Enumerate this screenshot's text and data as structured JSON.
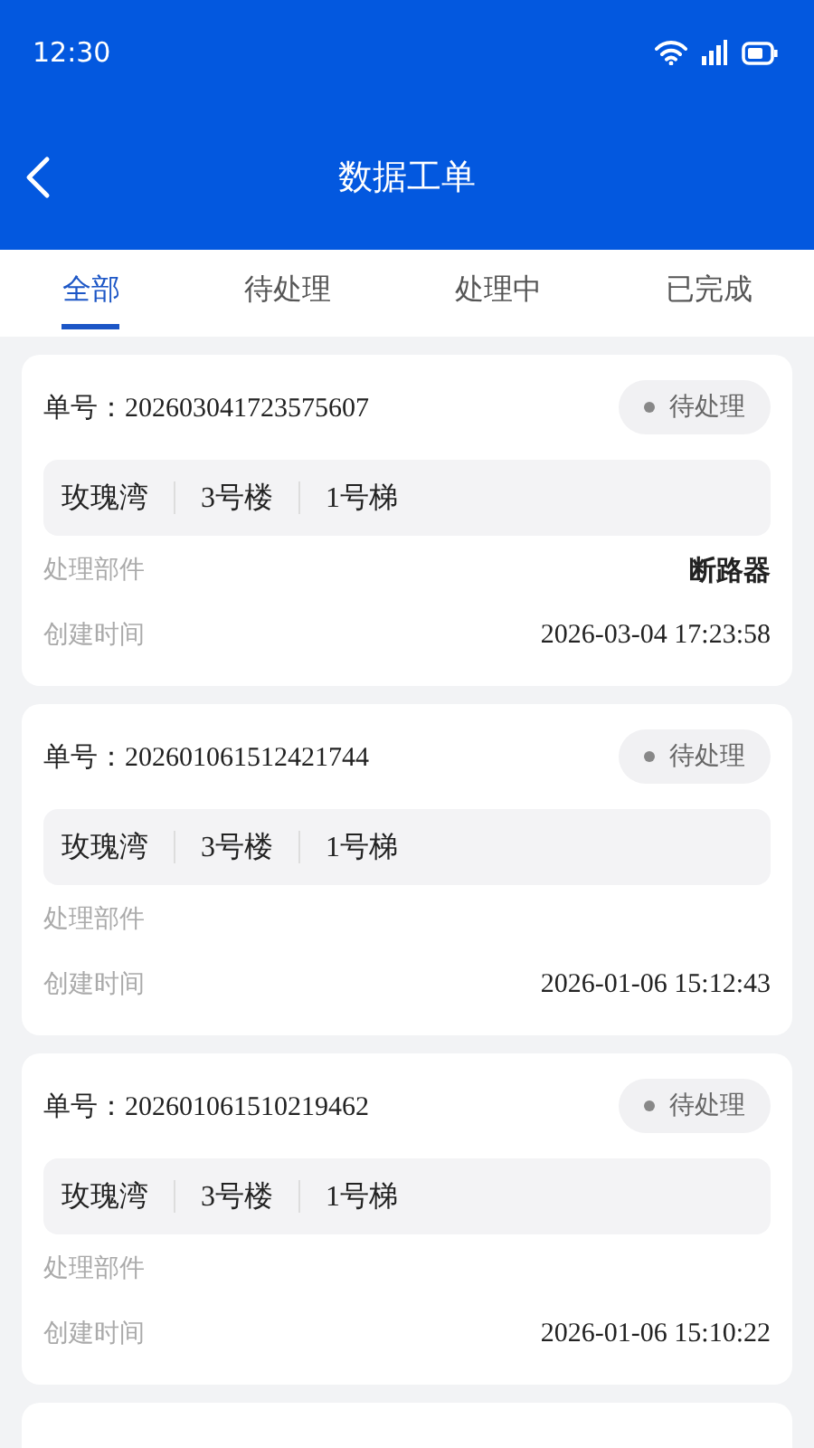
{
  "status_bar": {
    "time": "12:30"
  },
  "header": {
    "title": "数据工单"
  },
  "tabs": [
    {
      "label": "全部",
      "selected": true
    },
    {
      "label": "待处理",
      "selected": false
    },
    {
      "label": "处理中",
      "selected": false
    },
    {
      "label": "已完成",
      "selected": false
    }
  ],
  "orders": [
    {
      "number_label": "单号：",
      "number": "202603041723575607",
      "status": "待处理",
      "location": [
        "玫瑰湾",
        "3号楼",
        "1号梯"
      ],
      "part_label": "处理部件",
      "part": "断路器",
      "time_label": "创建时间",
      "time": "2026-03-04 17:23:58"
    },
    {
      "number_label": "单号：",
      "number": "202601061512421744",
      "status": "待处理",
      "location": [
        "玫瑰湾",
        "3号楼",
        "1号梯"
      ],
      "part_label": "处理部件",
      "time_label": "创建时间",
      "time": "2026-01-06 15:12:43"
    },
    {
      "number_label": "单号：",
      "number": "202601061510219462",
      "status": "待处理",
      "location": [
        "玫瑰湾",
        "3号楼",
        "1号梯"
      ],
      "part_label": "处理部件",
      "time_label": "创建时间",
      "time": "2026-01-06 15:10:22"
    }
  ]
}
